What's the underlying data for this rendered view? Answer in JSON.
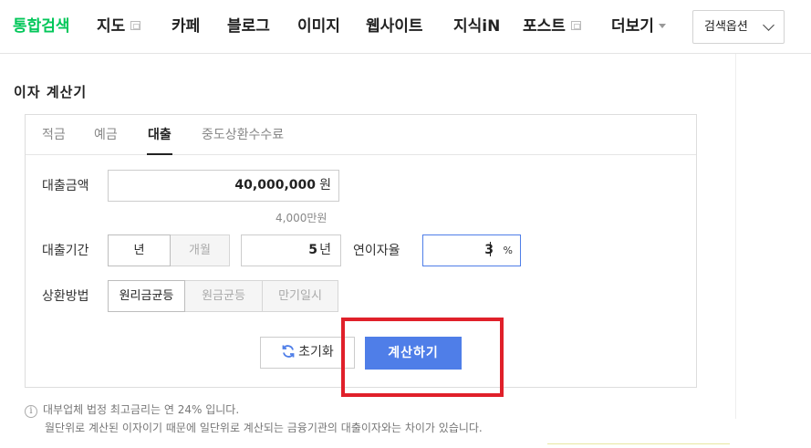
{
  "nav": {
    "items": [
      {
        "label": "통합검색",
        "active": true
      },
      {
        "label": "지도",
        "ext": true
      },
      {
        "label": "카페"
      },
      {
        "label": "블로그"
      },
      {
        "label": "이미지"
      },
      {
        "label": "웹사이트"
      },
      {
        "label": "지식iN"
      },
      {
        "label": "포스트",
        "ext": true
      },
      {
        "label": "더보기",
        "dropdown": true
      }
    ],
    "search_option": "검색옵션"
  },
  "calculator": {
    "title": "이자 계산기",
    "tabs": [
      "적금",
      "예금",
      "대출",
      "중도상환수수료"
    ],
    "active_tab": "대출",
    "amount": {
      "label": "대출금액",
      "value": "40,000,000",
      "unit": "원",
      "note": "4,000만원"
    },
    "period": {
      "label": "대출기간",
      "unit_options": [
        "년",
        "개월"
      ],
      "selected_unit": "년",
      "value": "5",
      "unit": "년"
    },
    "rate": {
      "label": "연이자율",
      "value": "3",
      "unit": "%"
    },
    "repayment": {
      "label": "상환방법",
      "options": [
        "원리금균등",
        "원금균등",
        "만기일시"
      ],
      "selected": "원리금균등"
    },
    "reset_label": "초기화",
    "calc_label": "계산하기"
  },
  "info": {
    "line1": "대부업체 법정 최고금리는 연 24% 입니다.",
    "line2": "월단위로 계산된 이자이기 때문에 일단위로 계산되는 금융기관의 대출이자와는 차이가 있습니다."
  },
  "colors": {
    "brand_green": "#03c75a",
    "button_blue": "#4f7ee8",
    "highlight_red": "#e0202a"
  }
}
